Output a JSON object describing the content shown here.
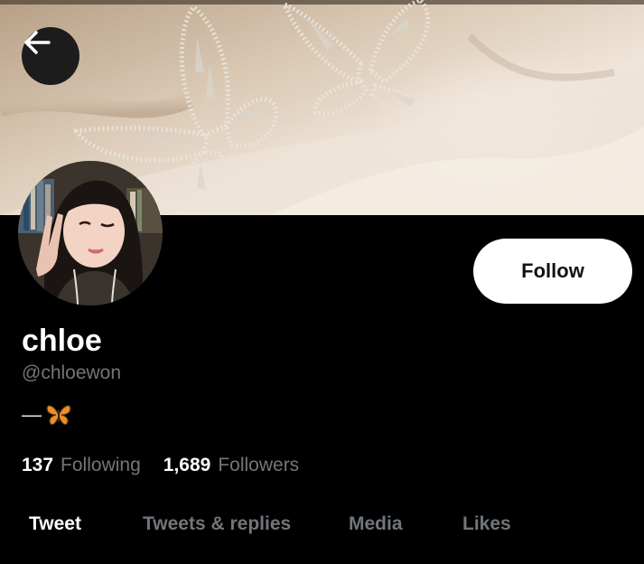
{
  "header": {
    "back_label": "Back"
  },
  "profile": {
    "display_name": "chloe",
    "handle": "@chloewon",
    "bio_text": "—",
    "bio_emoji": "butterfly",
    "follow_label": "Follow"
  },
  "stats": {
    "following_count": "137",
    "following_label": "Following",
    "followers_count": "1,689",
    "followers_label": "Followers"
  },
  "tabs": [
    {
      "label": "Tweet",
      "active": true
    },
    {
      "label": "Tweets & replies",
      "active": false
    },
    {
      "label": "Media",
      "active": false
    },
    {
      "label": "Likes",
      "active": false
    }
  ],
  "colors": {
    "background": "#000000",
    "text_primary": "#ffffff",
    "text_secondary": "#71767b",
    "follow_button_bg": "#ffffff",
    "follow_button_text": "#0f1419"
  }
}
